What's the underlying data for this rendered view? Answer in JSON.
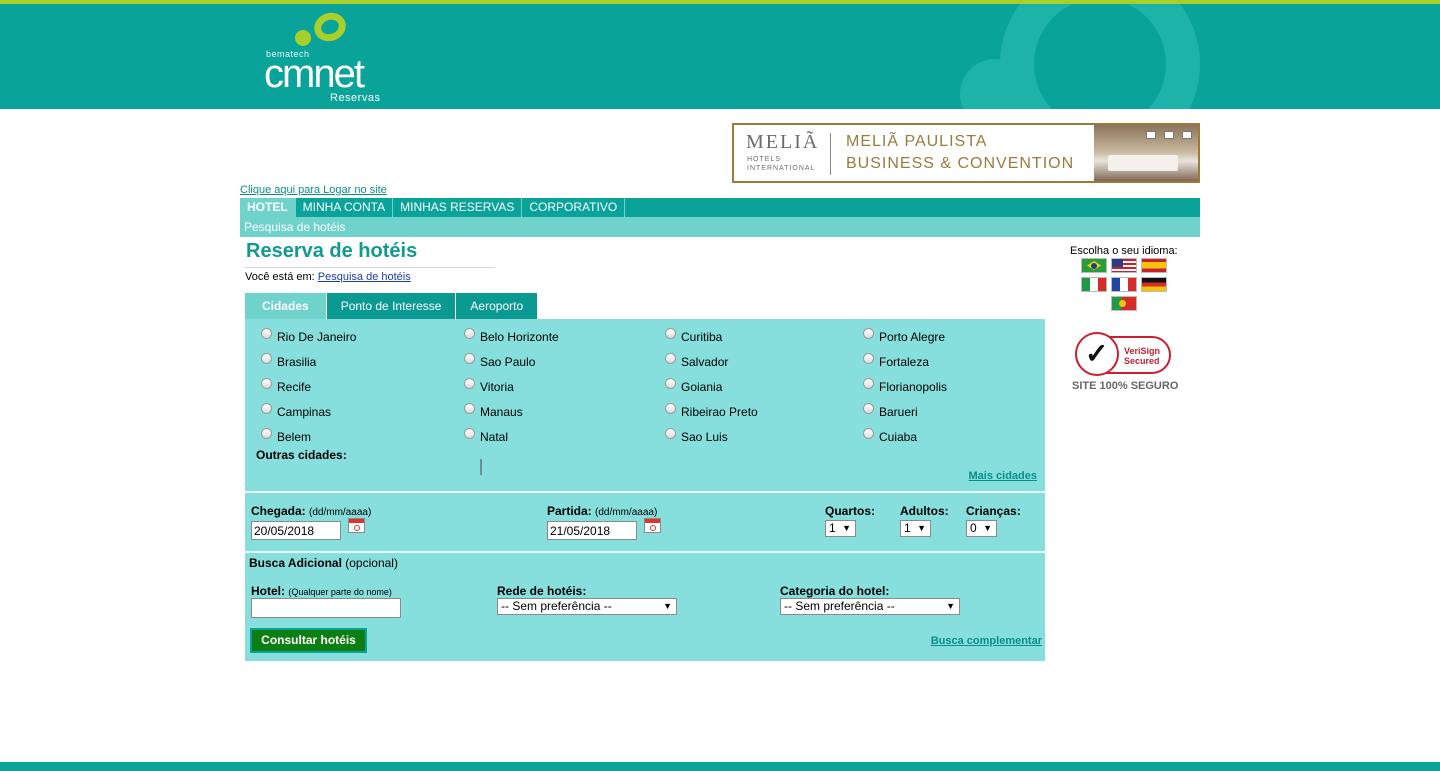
{
  "header": {
    "logo_small": "bematech",
    "logo_brand": "cmnet",
    "logo_sub": "Reservas",
    "colors": {
      "header_bg": "#0aa39a",
      "accent_line": "#a8cf2a"
    }
  },
  "banner": {
    "logo": "MELIÃ",
    "logo_sub": "HOTELS INTERNATIONAL",
    "line1": "MELIÃ PAULISTA",
    "line2": "BUSINESS & CONVENTION"
  },
  "login_link": "Clique aqui para Logar no site",
  "nav": {
    "tabs": [
      {
        "label": "HOTEL",
        "active": true
      },
      {
        "label": "MINHA CONTA",
        "active": false
      },
      {
        "label": "MINHAS RESERVAS",
        "active": false
      },
      {
        "label": "CORPORATIVO",
        "active": false
      }
    ],
    "subnav": "Pesquisa de hotéis"
  },
  "page": {
    "title": "Reserva de hotéis",
    "breadcrumb_prefix": "Você está em:",
    "breadcrumb_link": "Pesquisa de hotéis"
  },
  "search_tabs": [
    {
      "label": "Cidades",
      "active": true
    },
    {
      "label": "Ponto de Interesse",
      "active": false
    },
    {
      "label": "Aeroporto",
      "active": false
    }
  ],
  "cities": [
    [
      "Rio De Janeiro",
      "Belo Horizonte",
      "Curitiba",
      "Porto Alegre"
    ],
    [
      "Brasilia",
      "Sao Paulo",
      "Salvador",
      "Fortaleza"
    ],
    [
      "Recife",
      "Vitoria",
      "Goiania",
      "Florianopolis"
    ],
    [
      "Campinas",
      "Manaus",
      "Ribeirao Preto",
      "Barueri"
    ],
    [
      "Belem",
      "Natal",
      "Sao Luis",
      "Cuiaba"
    ]
  ],
  "outras_cidades": "Outras cidades:",
  "mais_cidades": "Mais cidades",
  "form": {
    "chegada_label": "Chegada:",
    "chegada_hint": "(dd/mm/aaaa)",
    "chegada_value": "20/05/2018",
    "partida_label": "Partida:",
    "partida_hint": "(dd/mm/aaaa)",
    "partida_value": "21/05/2018",
    "quartos_label": "Quartos:",
    "quartos_value": "1",
    "adultos_label": "Adultos:",
    "adultos_value": "1",
    "criancas_label": "Crianças:",
    "criancas_value": "0",
    "busca_adicional": "Busca Adicional",
    "busca_adicional_opt": "(opcional)",
    "hotel_label": "Hotel:",
    "hotel_hint": "(Qualquer parte do nome)",
    "hotel_value": "",
    "rede_label": "Rede de hotéis:",
    "rede_value": "-- Sem preferência --",
    "categoria_label": "Categoria do hotel:",
    "categoria_value": "-- Sem preferência --",
    "submit_label": "Consultar hotéis",
    "busca_complementar": "Busca complementar"
  },
  "sidebar": {
    "lang_title": "Escolha o seu idioma:",
    "flags": [
      "brazil-flag-icon",
      "usa-flag-icon",
      "spain-flag-icon",
      "italy-flag-icon",
      "france-flag-icon",
      "germany-flag-icon",
      "portugal-flag-icon"
    ],
    "verisign_line1": "VeriSign",
    "verisign_line2": "Secured",
    "site_seguro": "SITE 100% SEGURO"
  }
}
